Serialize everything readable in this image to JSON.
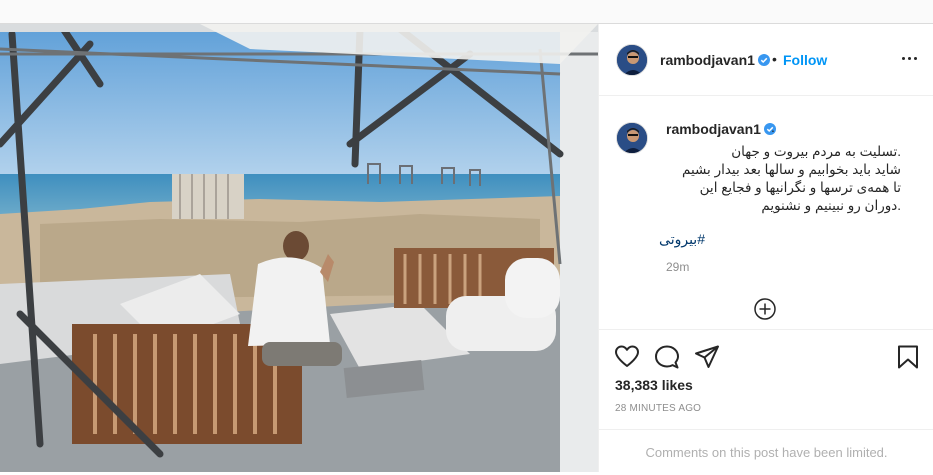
{
  "post": {
    "author": {
      "username": "rambodjavan1",
      "verified_icon": "verified-badge-icon",
      "follow_label": "Follow",
      "separator": "•"
    },
    "photo": {
      "description_icon": "post-photo"
    },
    "caption": {
      "username": "rambodjavan1",
      "trailing": ".",
      "lines": [
        ".تسلیت به مردم بیروت و جهان",
        "شاید باید بخوابیم و سالها بعد بیدار بشیم",
        "تا همه‌ی ترسها و نگرانیها و فجایع این",
        ".دوران رو نبینیم و نشنویم"
      ],
      "hashtag": "#بیروتی",
      "relative_time": "29m"
    },
    "likes": "38,383 likes",
    "timestamp": "28 MINUTES AGO",
    "comments_notice": "Comments on this post have been limited."
  },
  "icons": {
    "more": "more-options-icon",
    "like": "heart-icon",
    "comment": "comment-icon",
    "share": "paper-plane-icon",
    "save": "bookmark-icon",
    "load_more": "plus-circle-icon"
  },
  "colors": {
    "link": "#0095f6",
    "hashtag": "#00376b",
    "muted": "#8e8e8e"
  }
}
